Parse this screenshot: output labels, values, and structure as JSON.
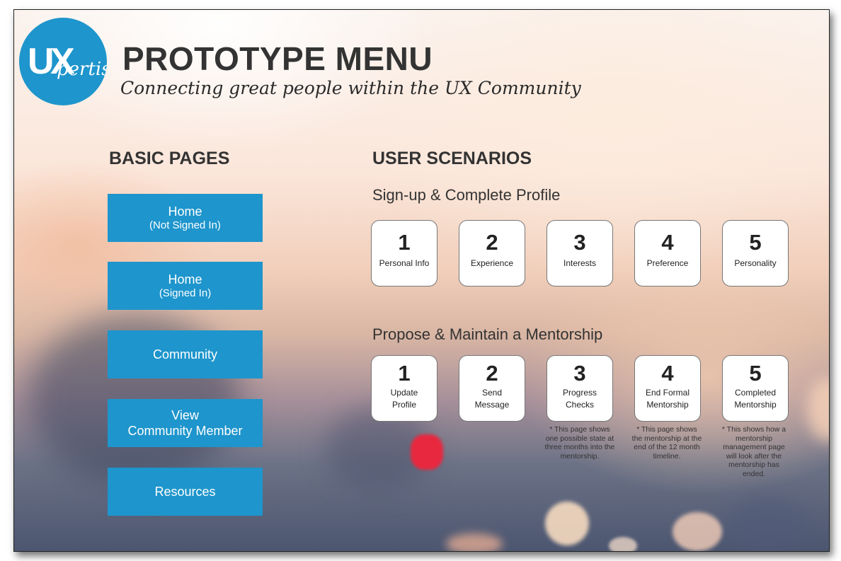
{
  "logo": {
    "letter_u": "U",
    "letter_x": "X",
    "rest": "pertise"
  },
  "header": {
    "title": "PROTOTYPE MENU",
    "subtitle": "Connecting great people within the UX Community"
  },
  "basic_pages": {
    "heading": "BASIC PAGES",
    "buttons": [
      {
        "line1": "Home",
        "line2": "(Not Signed In)"
      },
      {
        "line1": "Home",
        "line2": "(Signed In)"
      },
      {
        "line1": "Community",
        "line2": ""
      },
      {
        "line1": "View",
        "line2": "Community Member"
      },
      {
        "line1": "Resources",
        "line2": ""
      }
    ]
  },
  "user_scenarios": {
    "heading": "USER SCENARIOS",
    "signup": {
      "heading": "Sign-up & Complete Profile",
      "steps": [
        {
          "num": "1",
          "label": "Personal Info"
        },
        {
          "num": "2",
          "label": "Experience"
        },
        {
          "num": "3",
          "label": "Interests"
        },
        {
          "num": "4",
          "label": "Preference"
        },
        {
          "num": "5",
          "label": "Personality"
        }
      ]
    },
    "mentorship": {
      "heading": "Propose & Maintain a Mentorship",
      "steps": [
        {
          "num": "1",
          "label_l1": "Update",
          "label_l2": "Profile"
        },
        {
          "num": "2",
          "label_l1": "Send",
          "label_l2": "Message"
        },
        {
          "num": "3",
          "label_l1": "Progress",
          "label_l2": "Checks"
        },
        {
          "num": "4",
          "label_l1": "End Formal",
          "label_l2": "Mentorship"
        },
        {
          "num": "5",
          "label_l1": "Completed",
          "label_l2": "Mentorship"
        }
      ],
      "notes": [
        "* This page shows one possible state at three months into the mentorship.",
        "* This page shows the mentorship at the end of the 12 month timeline.",
        "* This shows how a mentorship management page will look after the mentorship has ended."
      ]
    }
  },
  "colors": {
    "accent": "#1e95cc",
    "heading": "#333333"
  }
}
